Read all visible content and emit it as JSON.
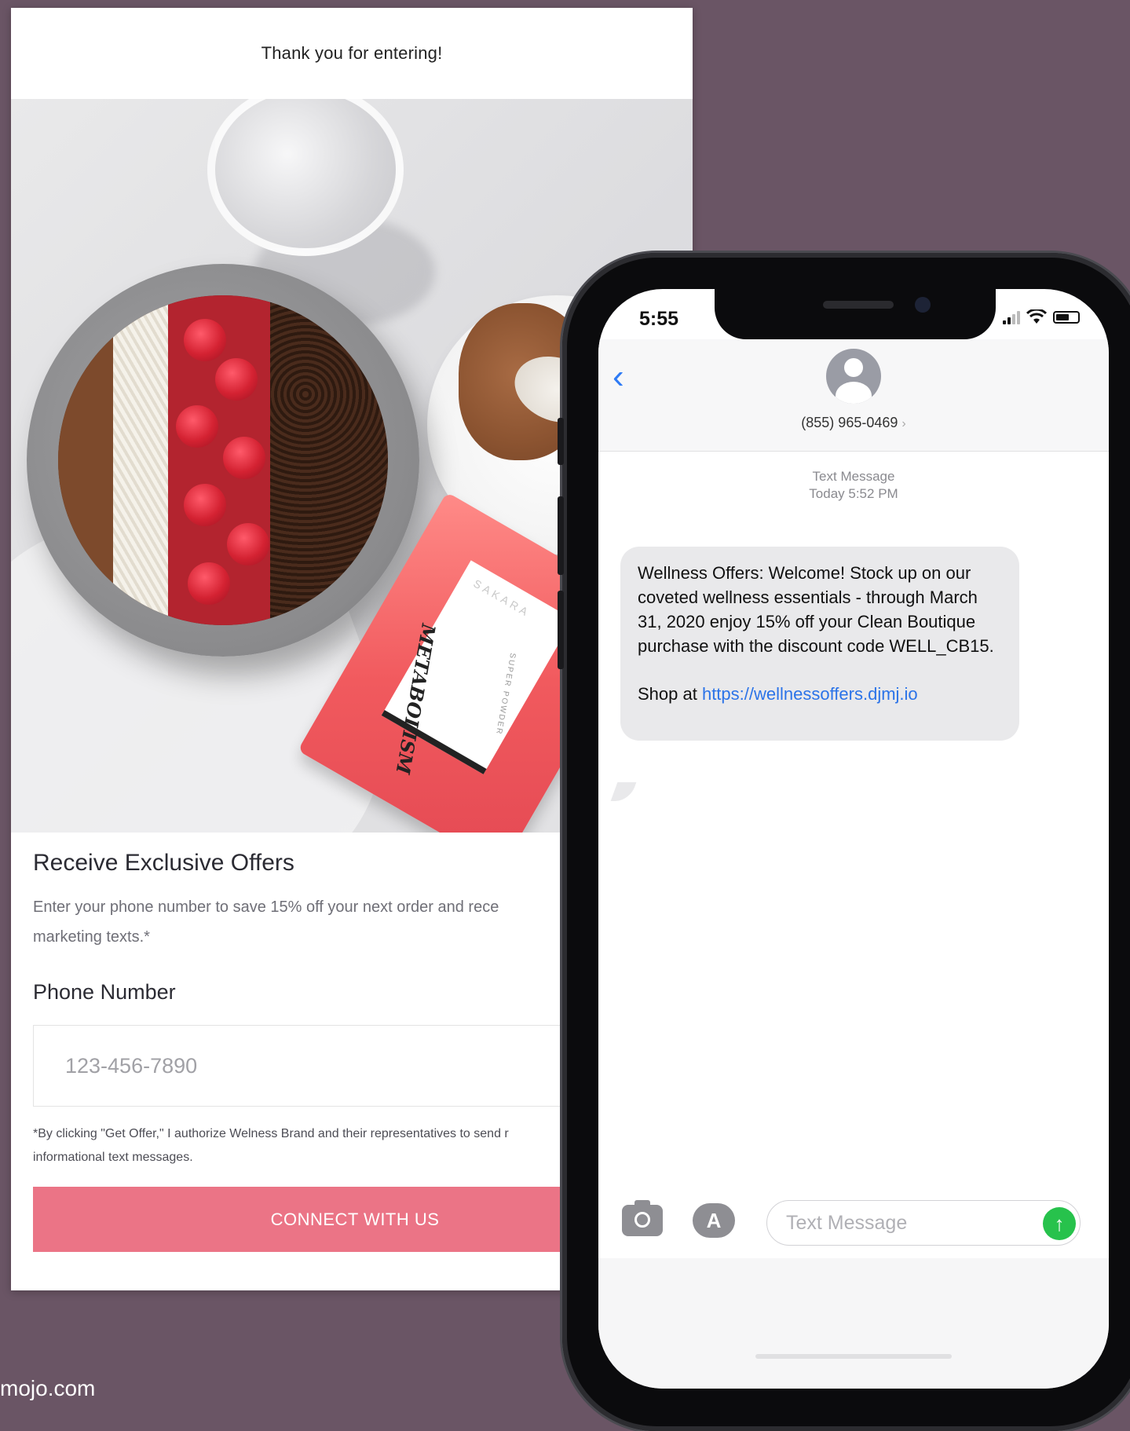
{
  "card": {
    "header": "Thank you for entering!",
    "product_brand": "SAKARA",
    "product_name": "METABOLISM",
    "product_sub": "SUPER POWDER",
    "heading": "Receive Exclusive Offers",
    "description": "Enter your phone number to save 15% off your next order and rece\nmarketing texts.*",
    "phone_label": "Phone Number",
    "phone_placeholder": "123-456-7890",
    "disclaimer": "*By clicking \"Get Offer,\" I authorize Welness Brand and their representatives to send r\ninformational text messages.",
    "cta": "CONNECT WITH US",
    "accent_color": "#eb7486"
  },
  "watermark": "mojo.com",
  "phone": {
    "time": "5:55",
    "back_icon": "chevron-left-icon",
    "contact": "(855) 965-0469",
    "meta_line1": "Text Message",
    "meta_line2": "Today 5:52 PM",
    "message": "Wellness Offers: Welcome! Stock up on our coveted wellness essentials - through March 31, 2020 enjoy 15% off your Clean Boutique purchase with the discount code WELL_CB15.",
    "shop_prefix": "Shop at ",
    "shop_link": "https://wellnessoffers.djmj.io",
    "input_placeholder": "Text Message",
    "link_color": "#2b73e8",
    "send_color": "#27c24c"
  }
}
